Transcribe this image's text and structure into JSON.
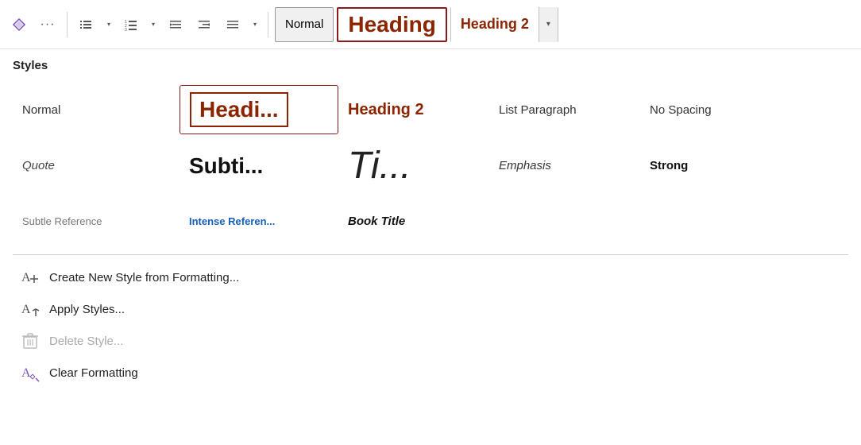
{
  "toolbar": {
    "style_normal_label": "Normal",
    "style_heading_label": "Heading",
    "style_heading2_label": "Heading 2",
    "more_label": "···",
    "dropdown_char": "▾"
  },
  "styles_panel": {
    "title": "Styles",
    "row1": [
      {
        "id": "normal",
        "label": "Normal",
        "class": "style-normal"
      },
      {
        "id": "heading1",
        "label": "Headi...",
        "class": "style-heading1"
      },
      {
        "id": "heading2",
        "label": "Heading 2",
        "class": "style-heading2"
      },
      {
        "id": "list-paragraph",
        "label": "List Paragraph",
        "class": "style-list-para"
      },
      {
        "id": "no-spacing",
        "label": "No Spacing",
        "class": "style-no-spacing"
      }
    ],
    "row2": [
      {
        "id": "quote",
        "label": "Quote",
        "class": "style-quote"
      },
      {
        "id": "subtitle",
        "label": "Subti...",
        "class": "style-subtitle"
      },
      {
        "id": "title",
        "label": "Ti...",
        "class": "style-title"
      },
      {
        "id": "emphasis",
        "label": "Emphasis",
        "class": "style-emphasis"
      },
      {
        "id": "strong",
        "label": "Strong",
        "class": "style-strong"
      }
    ],
    "row3": [
      {
        "id": "subtle-reference",
        "label": "Subtle Reference",
        "class": "style-subtle-ref"
      },
      {
        "id": "intense-reference",
        "label": "Intense Referen...",
        "class": "style-intense-ref"
      },
      {
        "id": "book-title",
        "label": "Book Title",
        "class": "style-book-title"
      }
    ],
    "actions": [
      {
        "id": "create-style",
        "label": "Create New Style from Formatting...",
        "icon": "A+",
        "disabled": false
      },
      {
        "id": "apply-styles",
        "label": "Apply Styles...",
        "icon": "A→",
        "disabled": false
      },
      {
        "id": "delete-style",
        "label": "Delete Style...",
        "icon": "🗑",
        "disabled": true
      },
      {
        "id": "clear-formatting",
        "label": "Clear Formatting",
        "icon": "A◇",
        "disabled": false
      }
    ]
  },
  "colors": {
    "heading_red": "#8B2500",
    "intense_ref_blue": "#1560bd",
    "border_red": "#8B1A1A"
  }
}
